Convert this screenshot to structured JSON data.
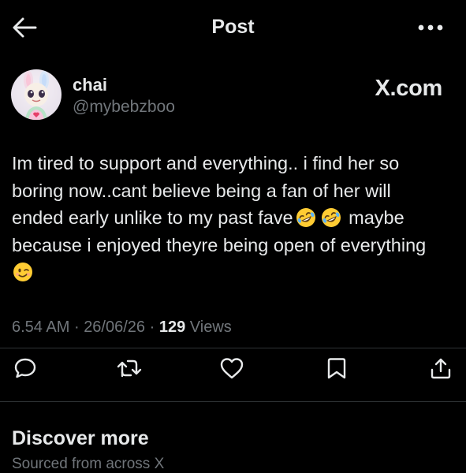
{
  "header": {
    "title": "Post",
    "back_icon": "arrow-left-icon",
    "more_icon": "more-horizontal-icon"
  },
  "author": {
    "display_name": "chai",
    "handle": "@mybebzboo",
    "avatar": "avatar-pastel-bunny-doll"
  },
  "source_label": "X.com",
  "tweet": {
    "lines": [
      "Im tired to support and everything.. i find her so",
      "boring now..cant believe being a fan of her will",
      "ended early unlike to my past fave",
      "maybe",
      "because i enjoyed theyre being open of everything"
    ],
    "emojis": [
      "rolling-on-floor-laughing-emoji",
      "rolling-on-floor-laughing-emoji",
      "winking-face-emoji"
    ]
  },
  "meta": {
    "time": "6.54 AM",
    "date": "26/06/26",
    "views_count": "129",
    "views_label": "Views",
    "separator": "·"
  },
  "actions": [
    "reply-icon",
    "retweet-icon",
    "like-icon",
    "bookmark-icon",
    "share-icon"
  ],
  "discover": {
    "title": "Discover more",
    "subtitle": "Sourced from across X"
  },
  "colors": {
    "background": "#000000",
    "text": "#e7e9ea",
    "secondary": "#71767b",
    "divider": "#2f3336"
  }
}
